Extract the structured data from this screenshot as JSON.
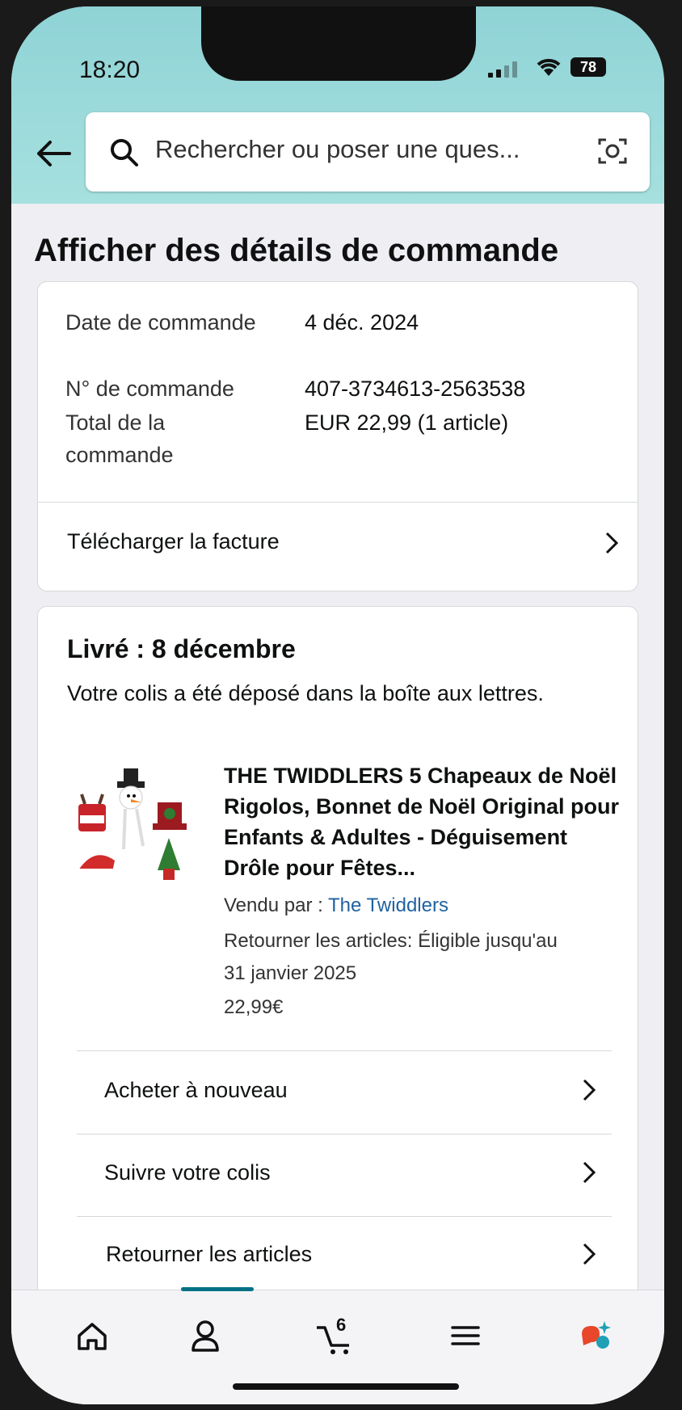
{
  "status_bar": {
    "time": "18:20",
    "battery": "78"
  },
  "search": {
    "placeholder": "Rechercher ou poser une ques..."
  },
  "page_title": "Afficher des détails de commande",
  "order_summary": {
    "date_label": "Date de commande",
    "date_value": "4 déc. 2024",
    "number_label": "N° de commande",
    "number_value": "407-3734613-2563538",
    "total_label": "Total de la commande",
    "total_value": "EUR 22,99 (1 article)",
    "invoice_link": "Télécharger la facture"
  },
  "delivery": {
    "title": "Livré : 8 décembre",
    "subtitle": "Votre colis a été déposé dans la boîte aux lettres.",
    "product": {
      "title": "THE TWIDDLERS 5 Chapeaux de Noël Rigolos, Bonnet de Noël Original pour Enfants & Adultes - Déguisement Drôle pour Fêtes...",
      "sold_by_label": "Vendu par  :",
      "seller": "The Twiddlers",
      "return_line1": "Retourner les articles: Éligible jusqu'au",
      "return_line2": "31 janvier 2025",
      "price": "22,99€"
    },
    "actions": [
      "Acheter à nouveau",
      "Suivre votre colis",
      "Retourner les articles"
    ]
  },
  "tabbar": {
    "cart_count": "6"
  },
  "colors": {
    "header": "#a6e0df",
    "link": "#2162a1",
    "accent": "#007185"
  }
}
